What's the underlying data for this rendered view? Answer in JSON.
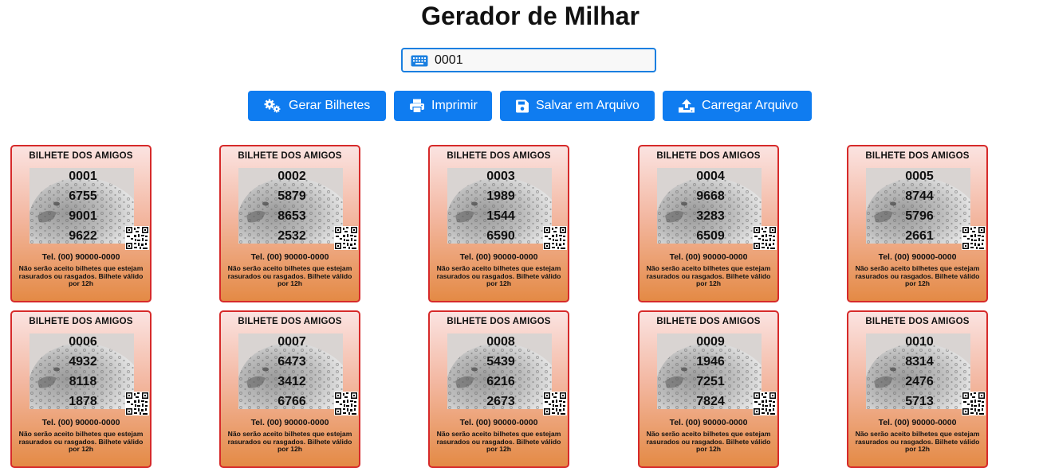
{
  "title": "Gerador de Milhar",
  "input": {
    "value": "0001",
    "icon": "keyboard-icon"
  },
  "buttons": [
    {
      "label": "Gerar Bilhetes",
      "icon": "gears-icon"
    },
    {
      "label": "Imprimir",
      "icon": "printer-icon"
    },
    {
      "label": "Salvar em Arquivo",
      "icon": "save-icon"
    },
    {
      "label": "Carregar Arquivo",
      "icon": "upload-icon"
    }
  ],
  "ticket_header": "BILHETE DOS AMIGOS",
  "ticket_tel": "Tel. (00) 90000-0000",
  "ticket_note": "Não serão aceito bilhetes que estejam rasurados ou rasgados. Bilhete válido por 12h",
  "tickets": [
    {
      "numbers": [
        "0001",
        "6755",
        "9001",
        "9622"
      ]
    },
    {
      "numbers": [
        "0002",
        "5879",
        "8653",
        "2532"
      ]
    },
    {
      "numbers": [
        "0003",
        "1989",
        "1544",
        "6590"
      ]
    },
    {
      "numbers": [
        "0004",
        "9668",
        "3283",
        "6509"
      ]
    },
    {
      "numbers": [
        "0005",
        "8744",
        "5796",
        "2661"
      ]
    },
    {
      "numbers": [
        "0006",
        "4932",
        "8118",
        "1878"
      ]
    },
    {
      "numbers": [
        "0007",
        "6473",
        "3412",
        "6766"
      ]
    },
    {
      "numbers": [
        "0008",
        "5439",
        "6216",
        "2673"
      ]
    },
    {
      "numbers": [
        "0009",
        "1946",
        "7251",
        "7824"
      ]
    },
    {
      "numbers": [
        "0010",
        "8314",
        "2476",
        "5713"
      ]
    }
  ],
  "colors": {
    "primary": "#0f7cf0",
    "ticket_border": "#d62a2a",
    "ticket_top": "#fbe3e1",
    "ticket_bottom": "#e48a45"
  }
}
